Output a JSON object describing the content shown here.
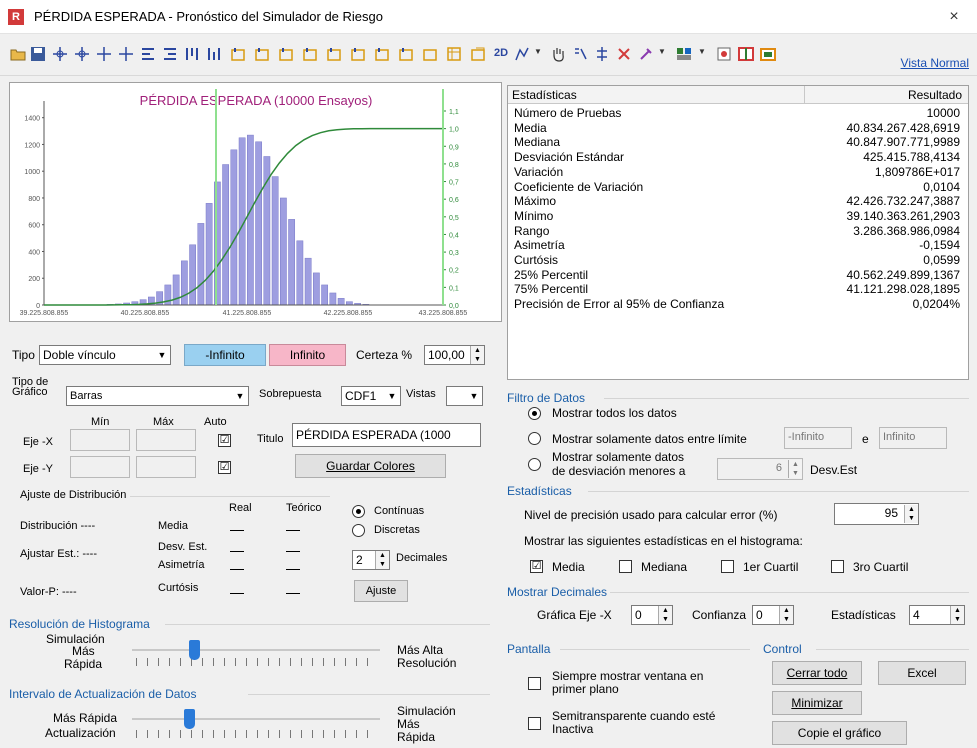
{
  "window": {
    "title": "PÉRDIDA ESPERADA - Pronóstico del Simulador de Riesgo",
    "close": "×"
  },
  "toolbar": {
    "label_2d": "2D",
    "vista_normal": "Vista Normal"
  },
  "chart": {
    "title": "PÉRDIDA ESPERADA (10000 Ensayos)"
  },
  "chart_data": {
    "type": "bar",
    "title": "PÉRDIDA ESPERADA (10000 Ensayos)",
    "x_ticks": [
      "39.225.808.855",
      "40.225.808.855",
      "41.225.808.855",
      "42.225.808.855",
      "43.225.808.855"
    ],
    "y_ticks": [
      "0",
      "200",
      "400",
      "600",
      "800",
      "1000",
      "1200",
      "1400"
    ],
    "y2_ticks": [
      "0,0",
      "0,1",
      "0,2",
      "0,3",
      "0,4",
      "0,5",
      "0,6",
      "0,7",
      "0,8",
      "0,9",
      "1,0",
      "1,1"
    ],
    "ylim": [
      0,
      1450
    ],
    "y2lim": [
      0,
      1.1
    ],
    "values": [
      5,
      8,
      15,
      25,
      40,
      60,
      100,
      150,
      225,
      330,
      450,
      610,
      760,
      920,
      1050,
      1160,
      1250,
      1270,
      1220,
      1110,
      960,
      800,
      640,
      480,
      350,
      240,
      150,
      90,
      50,
      25,
      12,
      5
    ],
    "cdf_series_name": "CDF"
  },
  "stats": {
    "col_name": "Estadísticas",
    "col_value": "Resultado",
    "rows": [
      {
        "name": "Número de Pruebas",
        "value": "10000"
      },
      {
        "name": "Media",
        "value": "40.834.267.428,6919"
      },
      {
        "name": "Mediana",
        "value": "40.847.907.771,9989"
      },
      {
        "name": "Desviación Estándar",
        "value": "425.415.788,4134"
      },
      {
        "name": "Variación",
        "value": "1,809786E+017"
      },
      {
        "name": "Coeficiente de Variación",
        "value": "0,0104"
      },
      {
        "name": "Máximo",
        "value": "42.426.732.247,3887"
      },
      {
        "name": "Mínimo",
        "value": "39.140.363.261,2903"
      },
      {
        "name": "Rango",
        "value": "3.286.368.986,0984"
      },
      {
        "name": "Asimetría",
        "value": "-0,1594"
      },
      {
        "name": "Curtósis",
        "value": "0,0599"
      },
      {
        "name": "25% Percentil",
        "value": "40.562.249.899,1367"
      },
      {
        "name": "75% Percentil",
        "value": "41.121.298.028,1895"
      },
      {
        "name": "Precisión de Error al 95% de Confianza",
        "value": "0,0204%"
      }
    ]
  },
  "tipo": {
    "label": "Tipo",
    "value": "Doble vínculo",
    "left": "-Infinito",
    "right": "Infinito",
    "certeza_label": "Certeza %",
    "certeza": "100,00"
  },
  "grafico": {
    "label1": "Tipo de",
    "label2": "Gráfico",
    "value": "Barras",
    "sobrepuesta_label": "Sobrepuesta",
    "sobrepuesta": "CDF1",
    "vistas_label": "Vistas",
    "vistas": ""
  },
  "axes": {
    "min": "Mín",
    "max": "Máx",
    "auto": "Auto",
    "ejex": "Eje -X",
    "ejey": "Eje -Y",
    "titulo_label": "Titulo",
    "titulo": "PÉRDIDA ESPERADA (1000",
    "guardar": "Guardar Colores",
    "check": "☑"
  },
  "ajuste": {
    "heading": "Ajuste de Distribución",
    "real": "Real",
    "teorico": "Teórico",
    "dist": "Distribución ----",
    "ajustar": "Ajustar Est.: ----",
    "valorp": "Valor-P: ----",
    "media": "Media",
    "desv": "Desv. Est.",
    "asim": "Asimetría",
    "curt": "Curtósis",
    "dash": "----",
    "continuas": "Contínuas",
    "discretas": "Discretas",
    "decimales": "2",
    "decimales_label": "Decimales",
    "ajuste_btn": "Ajuste"
  },
  "resolucion": {
    "heading": "Resolución de Histograma",
    "l1": "Simulación",
    "l2": "Más",
    "l3": "Rápida",
    "r1": "Más Alta",
    "r2": "Resolución",
    "level": 0.25
  },
  "intervalo": {
    "heading": "Intervalo de Actualización de Datos",
    "l1": "Más Rápida",
    "l2": "Actualización",
    "r1": "Simulación",
    "r2": "Más",
    "r3": "Rápida",
    "level": 0.23
  },
  "filtro": {
    "heading": "Filtro de Datos",
    "opt1": "Mostrar todos los datos",
    "opt2": "Mostrar solamente datos entre límite",
    "lim1": "-Infinito",
    "e": "e",
    "lim2": "Infinito",
    "opt3a": "Mostrar solamente datos",
    "opt3b": "de desviación menores a",
    "desv": "6",
    "desv_label": "Desv.Est"
  },
  "estadisticas": {
    "heading": "Estadísticas",
    "nivel_label": "Nivel de precisión usado para calcular error (%)",
    "nivel": "95",
    "mostrar": "Mostrar las siguientes estadísticas en el histograma:",
    "media": "Media",
    "mediana": "Mediana",
    "q1": "1er Cuartil",
    "q3": "3ro Cuartil"
  },
  "decimales": {
    "heading": "Mostrar Decimales",
    "ejex_label": "Gráfica Eje -X",
    "ejex": "0",
    "conf_label": "Confianza",
    "conf": "0",
    "est_label": "Estadísticas",
    "est": "4"
  },
  "pantalla": {
    "heading": "Pantalla",
    "opt1a": "Siempre mostrar ventana en",
    "opt1b": "primer plano",
    "opt2a": "Semitransparente cuando esté",
    "opt2b": "Inactiva"
  },
  "control": {
    "heading": "Control",
    "cerrar": "Cerrar todo",
    "excel": "Excel",
    "minimizar": "Minimizar",
    "copie": "Copie el gráfico"
  },
  "colors": {
    "bar": "#9e9ee0",
    "cdf": "#2f8a3a",
    "accent": "#1a5ea8",
    "title": "#a0207a",
    "pink": "#f7b6c8",
    "blue": "#9ad0f0"
  }
}
